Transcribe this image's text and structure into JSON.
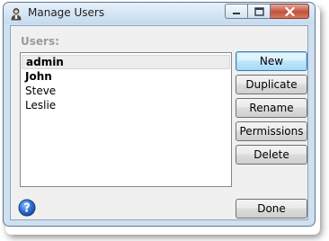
{
  "window": {
    "title": "Manage Users",
    "app_icon": "user-icon",
    "caption_buttons": [
      "minimize-icon",
      "maximize-icon",
      "close-icon"
    ]
  },
  "users_panel": {
    "label": "Users:",
    "items": [
      {
        "name": "admin",
        "bold": true,
        "selected": true
      },
      {
        "name": "John",
        "bold": true,
        "selected": false
      },
      {
        "name": "Steve",
        "bold": false,
        "selected": false
      },
      {
        "name": "Leslie",
        "bold": false,
        "selected": false
      }
    ]
  },
  "buttons": {
    "new": "New",
    "duplicate": "Duplicate",
    "rename": "Rename",
    "permissions": "Permissions",
    "delete": "Delete",
    "done": "Done"
  },
  "help": {
    "icon": "help-icon",
    "color": "#2f6fd0"
  },
  "colors": {
    "accent": "#3c7fb1",
    "close": "#c4533c"
  }
}
